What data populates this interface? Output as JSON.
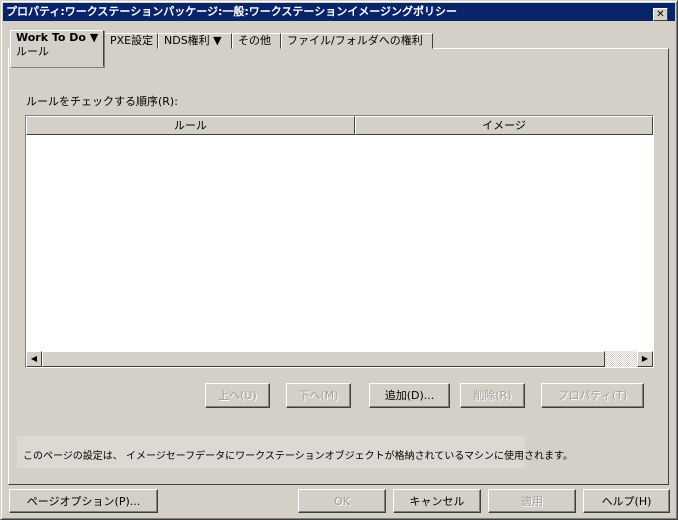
{
  "window": {
    "title": "プロパティ:ワークステーションパッケージ:一般:ワークステーションイメージングポリシー",
    "close": "✕"
  },
  "tabs": [
    {
      "label": "Work To Do ▼",
      "sub": "ルール"
    },
    {
      "label": "PXE設定"
    },
    {
      "label": "NDS権利 ▼"
    },
    {
      "label": "その他"
    },
    {
      "label": "ファイル/フォルダへの権利"
    }
  ],
  "rules": {
    "label": "ルールをチェックする順序(R):",
    "columns": [
      "ルール",
      "イメージ"
    ],
    "rows": []
  },
  "buttons": {
    "up": "上へ(U)",
    "down": "下へ(M)",
    "add": "追加(D)...",
    "delete": "削除(R)",
    "properties": "プロパティ(T)"
  },
  "info": "このページの設定は、 イメージセーフデータにワークステーションオブジェクトが格納されているマシンに使用されます。",
  "footer": {
    "page_options": "ページオプション(P)...",
    "ok": "OK",
    "cancel": "キャンセル",
    "apply": "適用",
    "help": "ヘルプ(H)"
  }
}
